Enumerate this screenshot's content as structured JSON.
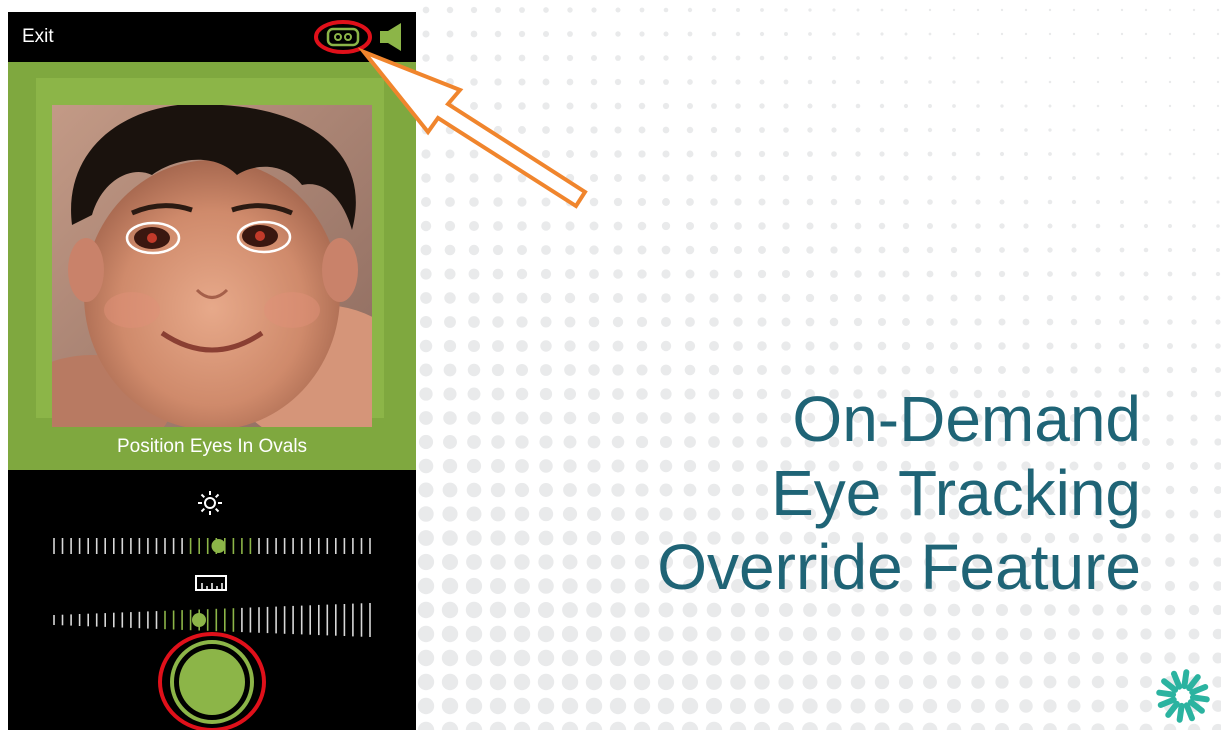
{
  "phone": {
    "exit_label": "Exit",
    "instruction": "Position Eyes In Ovals",
    "eye_tracking_icon": "eye-tracking-toggle-icon",
    "speaker_icon": "speaker-icon",
    "brightness_icon": "sun-icon",
    "size_icon": "ruler-icon",
    "brightness_level": 0.52,
    "size_level": 0.46,
    "capture_icon": "shutter-icon"
  },
  "slide": {
    "title_line1": "On-Demand",
    "title_line2": "Eye Tracking",
    "title_line3": "Override Feature",
    "logo_icon": "starburst-logo-icon"
  },
  "colors": {
    "accent_green": "#8cb548",
    "title_blue": "#1f6476",
    "highlight_red": "#e0101a",
    "arrow_orange": "#f0852d",
    "logo_teal": "#2bb3a0"
  }
}
